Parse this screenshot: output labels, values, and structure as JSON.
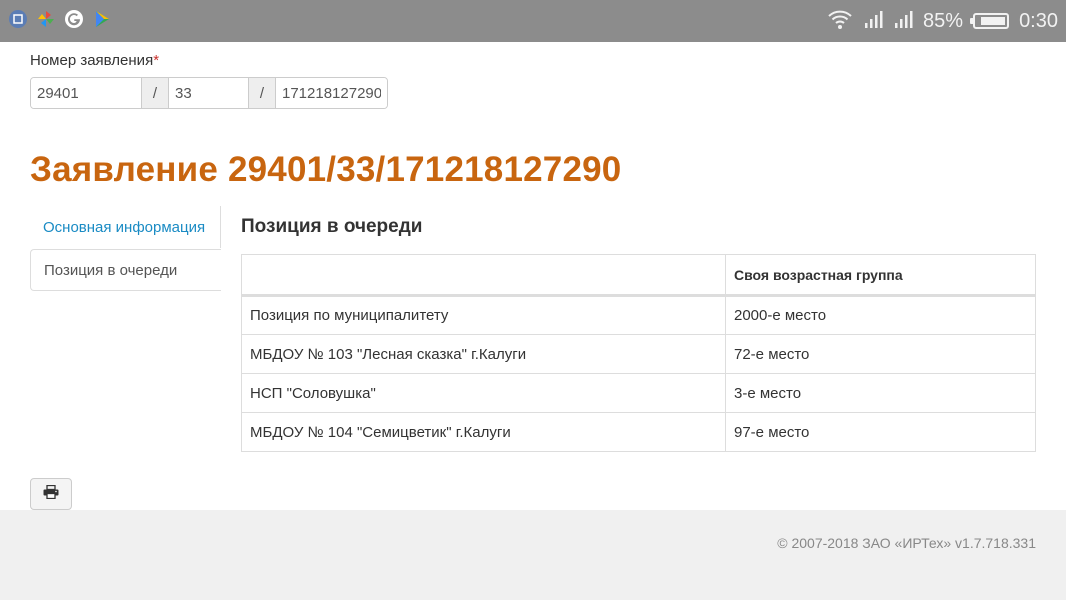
{
  "status_bar": {
    "app_icons": [
      "screenshot-icon",
      "pinwheel-icon",
      "google-icon",
      "play-store-icon"
    ],
    "battery_percent_text": "85%",
    "battery_level": 0.85,
    "time": "0:30"
  },
  "form": {
    "label": "Номер заявления",
    "required_mark": "*",
    "part1": "29401",
    "separator": "/",
    "part2": "33",
    "part3": "171218127290"
  },
  "page_title": "Заявление 29401/33/171218127290",
  "side_nav": {
    "items": [
      {
        "label": "Основная информация",
        "active": false
      },
      {
        "label": "Позиция в очереди",
        "active": true
      }
    ]
  },
  "section_title": "Позиция в очереди",
  "table": {
    "headers": [
      "",
      "Своя возрастная группа"
    ],
    "rows": [
      [
        "Позиция по муниципалитету",
        "2000-е место"
      ],
      [
        "МБДОУ № 103 \"Лесная сказка\" г.Калуги",
        "72-е место"
      ],
      [
        "НСП \"Соловушка\"",
        "3-е место"
      ],
      [
        "МБДОУ № 104 \"Семицветик\" г.Калуги",
        "97-е место"
      ]
    ]
  },
  "print_button": {
    "icon": "printer-icon"
  },
  "footer": {
    "copyright": "© 2007-2018 ЗАО «ИРТех» v1.7.718.331"
  },
  "colors": {
    "title": "#c8650f",
    "link": "#1a8bc4",
    "status_bar": "#8c8c8c"
  }
}
